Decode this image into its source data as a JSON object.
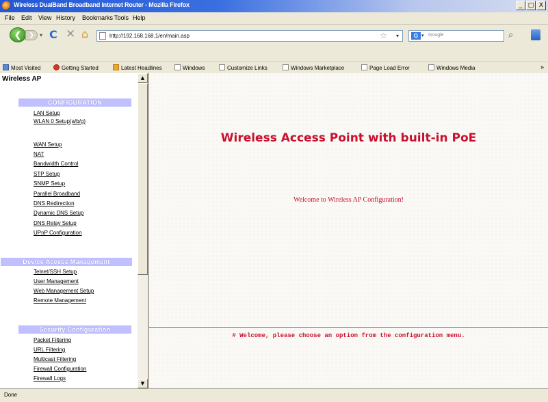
{
  "window": {
    "title": "Wireless DualBand Broadband Internet Router - Mozilla Firefox",
    "buttons": {
      "minimize": "_",
      "maximize": "□",
      "close": "X"
    }
  },
  "menu": [
    "File",
    "Edit",
    "View",
    "History",
    "Bookmarks",
    "Tools",
    "Help"
  ],
  "nav": {
    "url": "http://192.168.168.1/en/main.asp",
    "search_placeholder": "Google",
    "search_engine_letter": "G"
  },
  "bookmarks": [
    "Most Visited",
    "Getting Started",
    "Latest Headlines",
    "Windows",
    "Customize Links",
    "Windows Marketplace",
    "Page Load Error",
    "Windows Media"
  ],
  "bookmarks_overflow": "»",
  "sidebar": {
    "brand": "Wireless AP",
    "configuration": {
      "header": "CONFIGURATION",
      "items": [
        "LAN Setup",
        "WLAN 0 Setup(a/b/g)",
        "WAN Setup",
        "NAT",
        "Bandwidth Control",
        "STP Setup",
        "SNMP Setup",
        "Parallel Broadband",
        "DNS Redirection",
        "Dynamic DNS Setup",
        "DNS Relay Setup",
        "UPnP Configuration"
      ]
    },
    "device_access": {
      "header": "Device Access Management",
      "items": [
        "Telnet/SSH Setup",
        "User Management",
        "Web Management Setup",
        "Remote Management"
      ]
    },
    "security": {
      "header": "Security Configuration",
      "items": [
        "Packet Filtering",
        "URL Filtering",
        "Multicast Filtering",
        "Firewall Configuration",
        "Firewall Logs"
      ]
    }
  },
  "main": {
    "title": "Wireless Access Point with built-in PoE",
    "welcome": "Welcome to Wireless AP Configuration!"
  },
  "message": "# Welcome, please choose an option from the configuration menu.",
  "status": "Done"
}
